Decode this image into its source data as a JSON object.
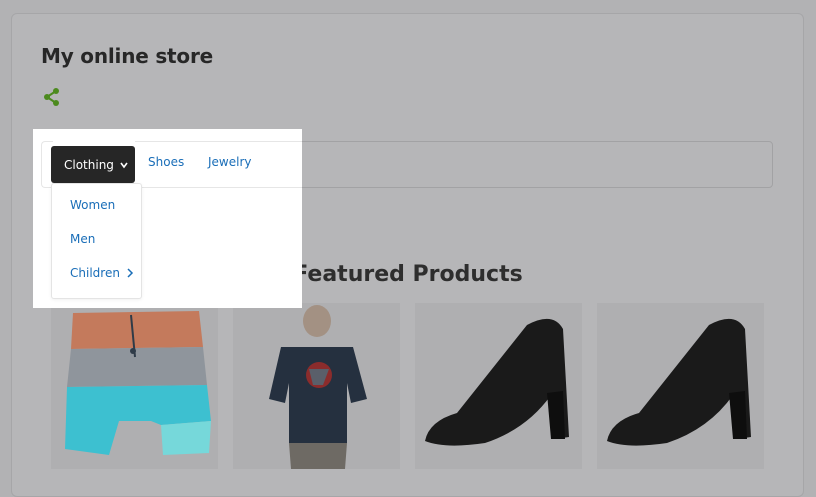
{
  "store": {
    "title": "My online store"
  },
  "nav": {
    "tabs": [
      {
        "label": "Clothing"
      },
      {
        "label": "Shoes"
      },
      {
        "label": "Jewelry"
      }
    ],
    "dropdown": [
      {
        "label": "Women"
      },
      {
        "label": "Men"
      },
      {
        "label": "Children"
      }
    ]
  },
  "featured": {
    "heading": "Featured Products"
  },
  "products": [
    {
      "name": "board-shorts"
    },
    {
      "name": "t-shirt"
    },
    {
      "name": "black-heel"
    },
    {
      "name": "black-heel"
    }
  ],
  "colors": {
    "accent": "#4c8a1e",
    "link": "#1a6eb8",
    "active_tab": "#262626",
    "overlay": "#b2b2b4"
  },
  "icons": {
    "share": "share-icon",
    "chevron": "chevron-down-icon",
    "submenu": "chevron-right-icon"
  }
}
